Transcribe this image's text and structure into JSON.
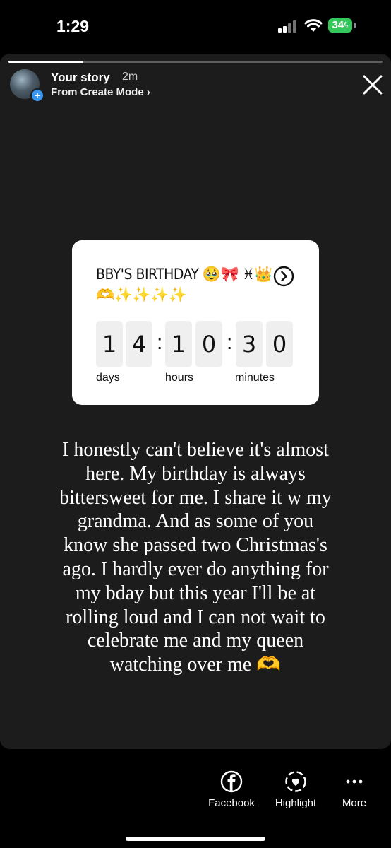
{
  "status": {
    "time": "1:29",
    "battery": "34"
  },
  "story": {
    "progress": 0.2,
    "username": "Your story",
    "posted_ago": "2m",
    "source": "From Create Mode ›"
  },
  "countdown": {
    "title": "BBY'S BIRTHDAY 🥹🎀 ♓👑🫶✨✨✨✨",
    "digits": [
      "1",
      "4",
      "1",
      "0",
      "3",
      "0"
    ],
    "units": {
      "days": "days",
      "hours": "hours",
      "minutes": "minutes"
    }
  },
  "caption": "I honestly can't believe it's almost here. My birthday is always bittersweet for me. I share it w my grandma. And as some of you know she passed two Christmas's ago. I hardly ever do anything for my bday but this year I'll be at rolling loud and I can not wait to celebrate me and my queen watching over me 🫶",
  "actions": {
    "facebook": "Facebook",
    "highlight": "Highlight",
    "more": "More"
  },
  "icons": [
    "signal-icon",
    "wifi-icon",
    "battery-icon",
    "close-icon",
    "arrow-right-circle-icon",
    "facebook-icon",
    "highlight-heart-icon",
    "more-dots-icon"
  ]
}
